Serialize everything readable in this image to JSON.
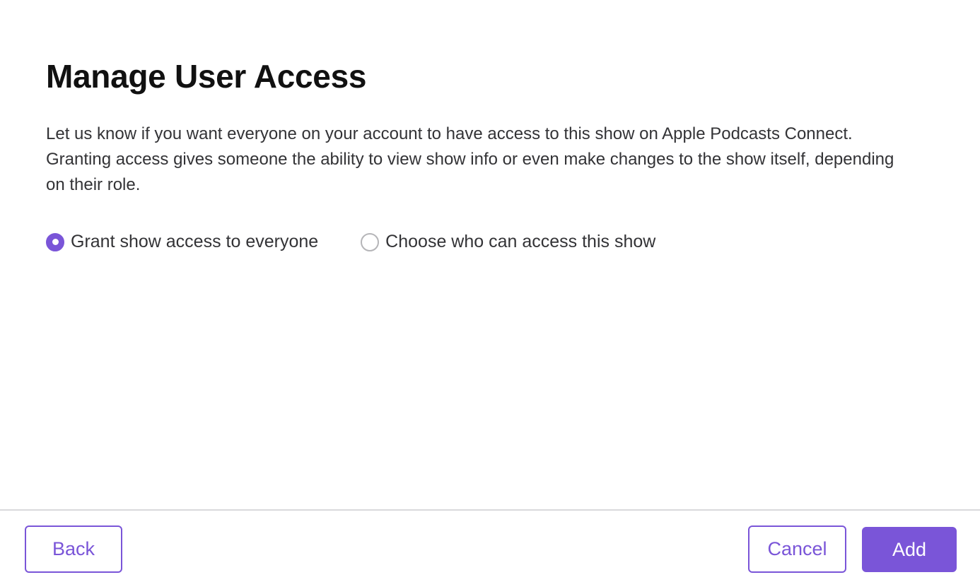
{
  "dialog": {
    "title": "Manage User Access",
    "description": "Let us know if you want everyone on your account to have access to this show on Apple Podcasts Connect. Granting access gives someone the ability to view show info or even make changes to the show itself, depending on their role.",
    "options": [
      {
        "label": "Grant show access to everyone",
        "selected": true
      },
      {
        "label": "Choose who can access this show",
        "selected": false
      }
    ]
  },
  "footer": {
    "back_label": "Back",
    "cancel_label": "Cancel",
    "add_label": "Add"
  },
  "colors": {
    "accent": "#7a55d8",
    "divider": "#d9d9dc",
    "text": "#333336"
  }
}
